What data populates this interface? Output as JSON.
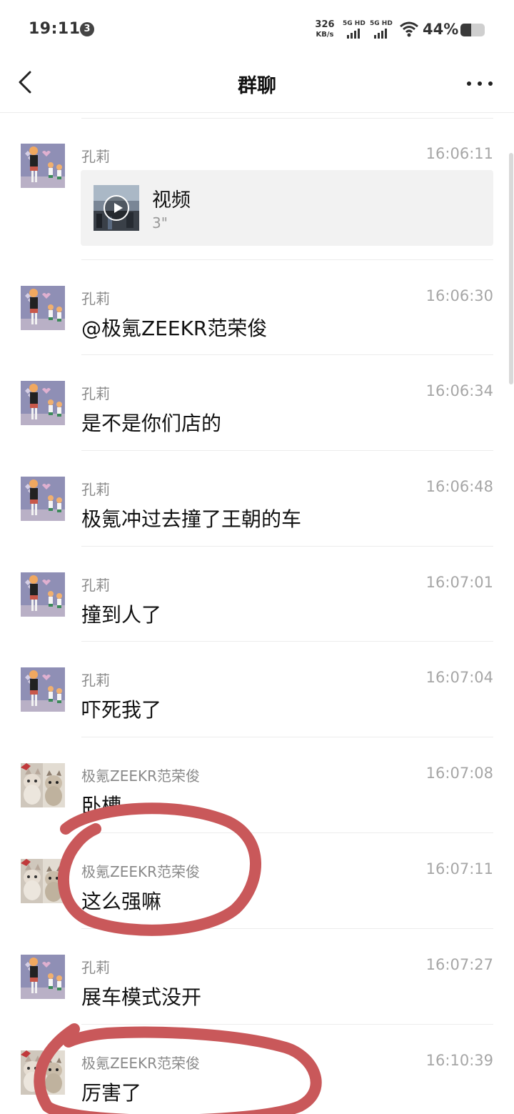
{
  "status_bar": {
    "time": "19:11",
    "notification_count": "3",
    "net_speed": "326",
    "net_unit": "KB/s",
    "sim1_label": "5G HD",
    "sim2_label": "5G HD",
    "wifi_icon": "wifi-icon",
    "battery_percent": "44%",
    "battery_level": 0.44
  },
  "nav": {
    "back_icon": "chevron-left-icon",
    "title": "群聊",
    "more_icon": "more-horizontal-icon"
  },
  "messages": [
    {
      "sender": "孔莉",
      "time": "16:06:11",
      "type": "video",
      "video_label": "视频",
      "video_duration": "3\""
    },
    {
      "sender": "孔莉",
      "time": "16:06:30",
      "type": "text",
      "text": "@极氪ZEEKR范荣俊"
    },
    {
      "sender": "孔莉",
      "time": "16:06:34",
      "type": "text",
      "text": "是不是你们店的"
    },
    {
      "sender": "孔莉",
      "time": "16:06:48",
      "type": "text",
      "text": "极氪冲过去撞了王朝的车"
    },
    {
      "sender": "孔莉",
      "time": "16:07:01",
      "type": "text",
      "text": "撞到人了"
    },
    {
      "sender": "孔莉",
      "time": "16:07:04",
      "type": "text",
      "text": "吓死我了"
    },
    {
      "sender": "极氪ZEEKR范荣俊",
      "time": "16:07:08",
      "type": "text",
      "text": "卧槽"
    },
    {
      "sender": "极氪ZEEKR范荣俊",
      "time": "16:07:11",
      "type": "text",
      "text": "这么强嘛"
    },
    {
      "sender": "孔莉",
      "time": "16:07:27",
      "type": "text",
      "text": "展车模式没开"
    },
    {
      "sender": "极氪ZEEKR范荣俊",
      "time": "16:10:39",
      "type": "text",
      "text": "厉害了"
    }
  ],
  "colors": {
    "annotation": "#c9585a",
    "divider": "#ececec",
    "video_card_bg": "#f2f2f2",
    "meta_text": "#8a8a8a"
  }
}
